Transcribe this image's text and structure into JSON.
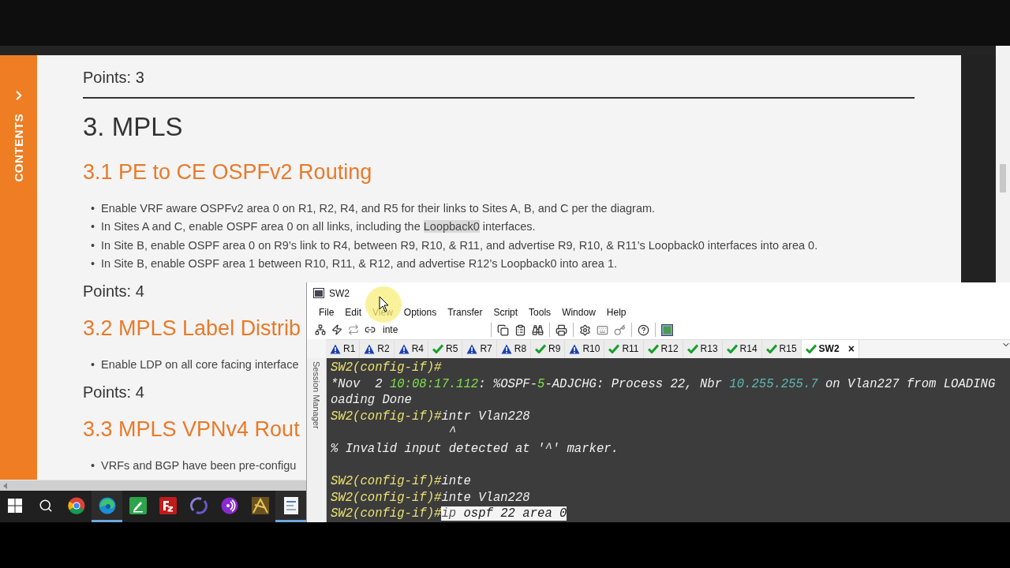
{
  "sidebar": {
    "label": "CONTENTS"
  },
  "document": {
    "blocks": [
      {
        "kind": "points",
        "text": "Points: 3"
      },
      {
        "kind": "rule"
      },
      {
        "kind": "h1",
        "text": "3. MPLS"
      },
      {
        "kind": "h2",
        "text": "3.1 PE to CE OSPFv2 Routing"
      },
      {
        "kind": "bullets",
        "marker": "•",
        "items": [
          {
            "parts": [
              {
                "text": "Enable VRF aware OSPFv2 area 0 on R1, R2, R4, and R5 for their links to Sites A, B, and C per the diagram.",
                "highlight": false
              }
            ]
          },
          {
            "parts": [
              {
                "text": "In Sites A and C, enable OSPF area 0 on all links, including the ",
                "highlight": false
              },
              {
                "text": "Loopback0",
                "highlight": true
              },
              {
                "text": " interfaces.",
                "highlight": false
              }
            ]
          },
          {
            "parts": [
              {
                "text": "In Site B, enable OSPF area 0 on R9’s link to R4, between R9, R10, & R11, and advertise R9, R10, & R11’s Loopback0 interfaces into area 0.",
                "highlight": false
              }
            ]
          },
          {
            "parts": [
              {
                "text": "In Site B, enable OSPF area 1 between R10, R11, & R12, and advertise R12’s Loopback0 into area 1.",
                "highlight": false
              }
            ]
          }
        ]
      },
      {
        "kind": "points",
        "text": "Points: 4"
      },
      {
        "kind": "h2",
        "text": "3.2 MPLS Label Distrib"
      },
      {
        "kind": "bullets",
        "marker": "•",
        "items": [
          {
            "parts": [
              {
                "text": "Enable LDP on all core facing interface",
                "highlight": false
              }
            ]
          }
        ]
      },
      {
        "kind": "points",
        "text": "Points: 4"
      },
      {
        "kind": "h2",
        "text": "3.3 MPLS VPNv4 Rout"
      },
      {
        "kind": "bullets",
        "marker": "•",
        "items": [
          {
            "parts": [
              {
                "text": "VRFs and BGP have been pre-configu",
                "highlight": false
              }
            ]
          }
        ]
      }
    ]
  },
  "terminal": {
    "title": "SW2",
    "menu": [
      "File",
      "Edit",
      "View",
      "Options",
      "Transfer",
      "Script",
      "Tools",
      "Window",
      "Help"
    ],
    "toolbar_field": "inte",
    "side_label": "Session Manager",
    "tabs": [
      {
        "label": "R1",
        "warning": true,
        "selected": false
      },
      {
        "label": "R2",
        "warning": true,
        "selected": false
      },
      {
        "label": "R4",
        "warning": true,
        "selected": false
      },
      {
        "label": "R5",
        "warning": false,
        "selected": false
      },
      {
        "label": "R7",
        "warning": true,
        "selected": false
      },
      {
        "label": "R8",
        "warning": true,
        "selected": false
      },
      {
        "label": "R9",
        "warning": false,
        "selected": false
      },
      {
        "label": "R10",
        "warning": true,
        "selected": false
      },
      {
        "label": "R11",
        "warning": false,
        "selected": false
      },
      {
        "label": "R12",
        "warning": false,
        "selected": false
      },
      {
        "label": "R13",
        "warning": false,
        "selected": false
      },
      {
        "label": "R14",
        "warning": false,
        "selected": false
      },
      {
        "label": "R15",
        "warning": false,
        "selected": false
      },
      {
        "label": "SW2",
        "warning": false,
        "selected": true
      }
    ],
    "close": "×",
    "lines": [
      {
        "segments": [
          {
            "text": "SW2(config-if)#",
            "color": "#e8e070"
          }
        ]
      },
      {
        "segments": [
          {
            "text": "*Nov  2 ",
            "color": "#f0f0f0"
          },
          {
            "text": "10:08:17.112",
            "color": "#7ee04a"
          },
          {
            "text": ": %OSPF-",
            "color": "#f0f0f0"
          },
          {
            "text": "5",
            "color": "#7ee04a"
          },
          {
            "text": "-ADJCHG: Process 22, Nbr ",
            "color": "#f0f0f0"
          },
          {
            "text": "10.255.255.7",
            "color": "#5fb8b0"
          },
          {
            "text": " on Vlan227 from LOADING",
            "color": "#f0f0f0"
          }
        ]
      },
      {
        "segments": [
          {
            "text": "oading Done",
            "color": "#f0f0f0"
          }
        ]
      },
      {
        "segments": [
          {
            "text": "SW2(config-if)#",
            "color": "#e8e070"
          },
          {
            "text": "intr Vlan228",
            "color": "#f0f0f0"
          }
        ]
      },
      {
        "segments": [
          {
            "text": "                ^",
            "color": "#f0f0f0"
          }
        ]
      },
      {
        "segments": [
          {
            "text": "% Invalid input detected at '^' marker.",
            "color": "#f0f0f0"
          }
        ]
      },
      {
        "kind": "blank"
      },
      {
        "segments": [
          {
            "text": "SW2(config-if)#",
            "color": "#e8e070"
          },
          {
            "text": "inte",
            "color": "#f0f0f0"
          }
        ]
      },
      {
        "segments": [
          {
            "text": "SW2(config-if)#",
            "color": "#e8e070"
          },
          {
            "text": "inte Vlan228",
            "color": "#f0f0f0"
          }
        ]
      },
      {
        "segments": [
          {
            "text": "SW2(config-if)#",
            "color": "#e8e070"
          },
          {
            "text": "ip",
            "color": "#5a5a5a",
            "selected": true
          },
          {
            "text": " ospf 22 area 0",
            "color": "#202020",
            "selected": true
          }
        ]
      }
    ]
  },
  "taskbar": [
    {
      "kind": "windows",
      "selected": false
    },
    {
      "kind": "search",
      "selected": false
    },
    {
      "kind": "chrome",
      "selected": false
    },
    {
      "kind": "edge",
      "selected": true
    },
    {
      "kind": "editor",
      "selected": false
    },
    {
      "kind": "filezilla",
      "selected": false
    },
    {
      "kind": "ring",
      "selected": false
    },
    {
      "kind": "podcast",
      "selected": false
    },
    {
      "kind": "compass",
      "selected": false
    },
    {
      "kind": "document",
      "selected": true
    }
  ]
}
